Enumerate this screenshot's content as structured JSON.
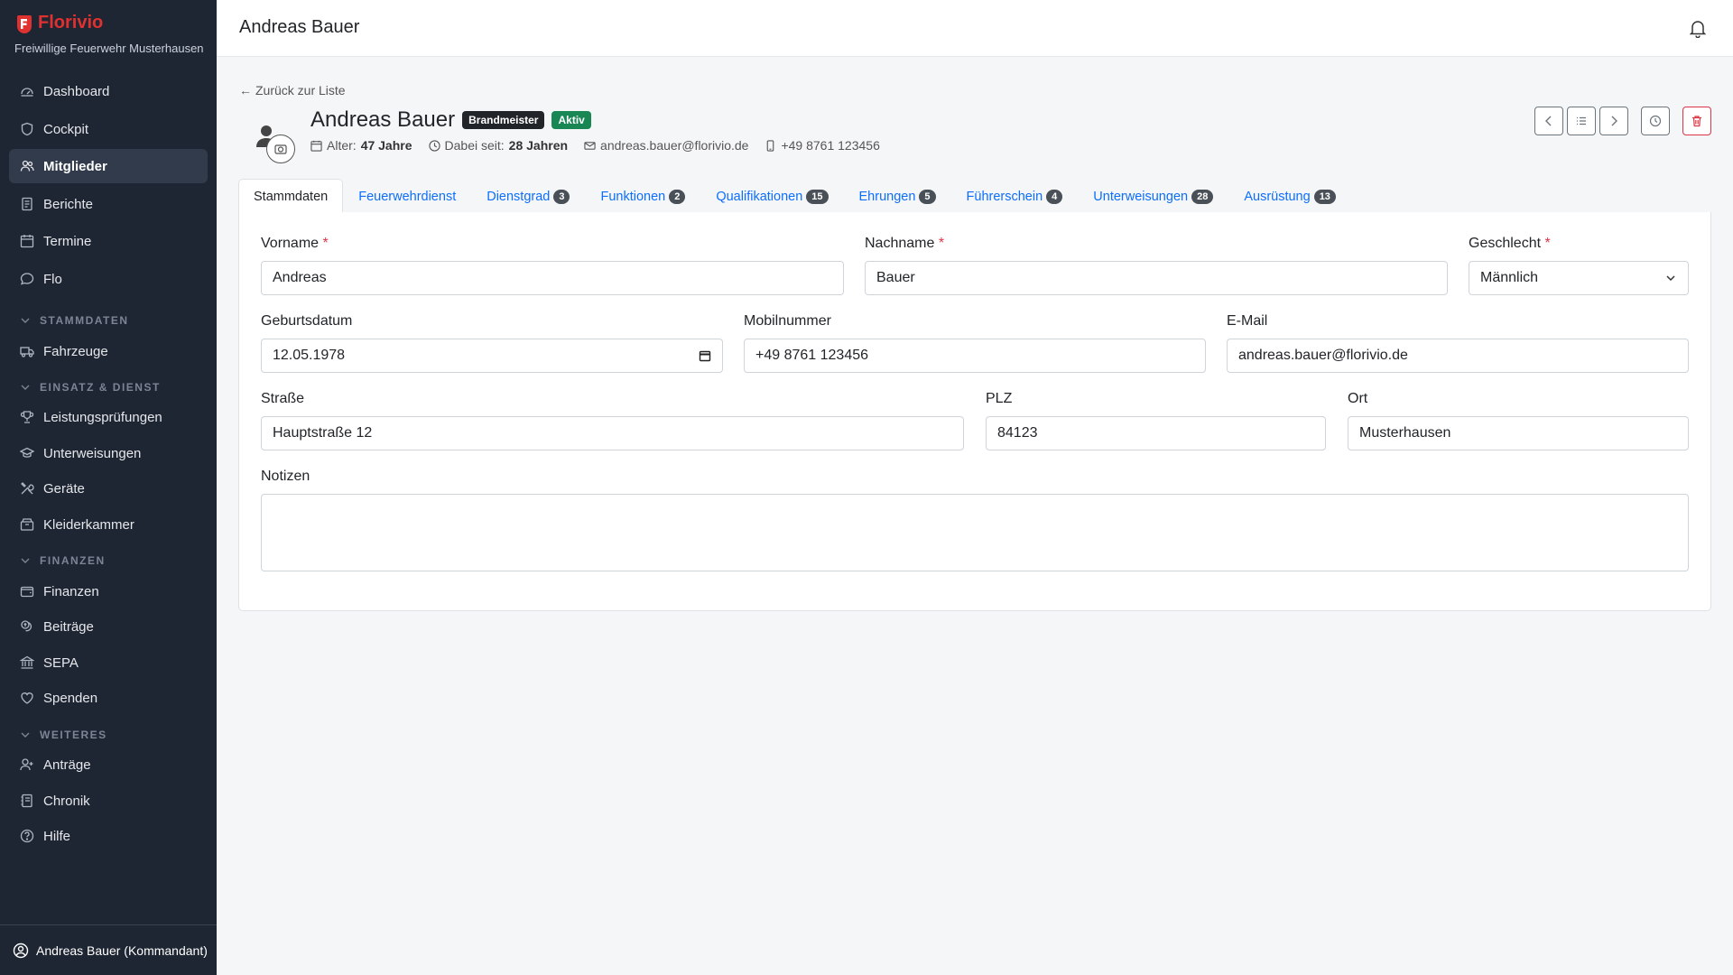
{
  "brand": {
    "name": "Florivio",
    "subtitle": "Freiwillige Feuerwehr Musterhausen"
  },
  "sidebar": {
    "items": [
      {
        "label": "Dashboard",
        "icon": "dashboard-icon"
      },
      {
        "label": "Cockpit",
        "icon": "shield-icon"
      },
      {
        "label": "Mitglieder",
        "icon": "users-icon",
        "active": true
      },
      {
        "label": "Berichte",
        "icon": "report-icon"
      },
      {
        "label": "Termine",
        "icon": "calendar-icon"
      },
      {
        "label": "Flo",
        "icon": "chat-icon"
      }
    ],
    "sections": [
      {
        "title": "STAMMDATEN",
        "items": [
          {
            "label": "Fahrzeuge",
            "icon": "truck-icon"
          }
        ]
      },
      {
        "title": "EINSATZ & DIENST",
        "items": [
          {
            "label": "Leistungsprüfungen",
            "icon": "trophy-icon"
          },
          {
            "label": "Unterweisungen",
            "icon": "graduation-icon"
          },
          {
            "label": "Geräte",
            "icon": "tools-icon"
          },
          {
            "label": "Kleiderkammer",
            "icon": "box-icon"
          }
        ]
      },
      {
        "title": "FINANZEN",
        "items": [
          {
            "label": "Finanzen",
            "icon": "wallet-icon"
          },
          {
            "label": "Beiträge",
            "icon": "coins-icon"
          },
          {
            "label": "SEPA",
            "icon": "bank-icon"
          },
          {
            "label": "Spenden",
            "icon": "heart-icon"
          }
        ]
      },
      {
        "title": "WEITERES",
        "items": [
          {
            "label": "Anträge",
            "icon": "user-add-icon"
          },
          {
            "label": "Chronik",
            "icon": "journal-icon"
          },
          {
            "label": "Hilfe",
            "icon": "help-icon"
          }
        ]
      }
    ],
    "footer_user": "Andreas Bauer (Kommandant)"
  },
  "topbar": {
    "title": "Andreas Bauer"
  },
  "main": {
    "back_label": "Zurück zur Liste",
    "person": {
      "name": "Andreas Bauer",
      "rank_badge": "Brandmeister",
      "status_badge": "Aktiv",
      "age_label": "Alter:",
      "age_value": "47 Jahre",
      "since_label": "Dabei seit:",
      "since_value": "28 Jahren",
      "email": "andreas.bauer@florivio.de",
      "phone": "+49 8761 123456"
    },
    "tabs": [
      {
        "label": "Stammdaten",
        "active": true
      },
      {
        "label": "Feuerwehrdienst"
      },
      {
        "label": "Dienstgrad",
        "count": "3"
      },
      {
        "label": "Funktionen",
        "count": "2"
      },
      {
        "label": "Qualifikationen",
        "count": "15"
      },
      {
        "label": "Ehrungen",
        "count": "5"
      },
      {
        "label": "Führerschein",
        "count": "4"
      },
      {
        "label": "Unterweisungen",
        "count": "28"
      },
      {
        "label": "Ausrüstung",
        "count": "13"
      }
    ],
    "form": {
      "vorname": {
        "label": "Vorname",
        "value": "Andreas"
      },
      "nachname": {
        "label": "Nachname",
        "value": "Bauer"
      },
      "geschlecht": {
        "label": "Geschlecht",
        "value": "Männlich"
      },
      "geburtsdatum": {
        "label": "Geburtsdatum",
        "value": "12.05.1978"
      },
      "mobilnummer": {
        "label": "Mobilnummer",
        "value": "+49 8761 123456"
      },
      "email": {
        "label": "E-Mail",
        "value": "andreas.bauer@florivio.de"
      },
      "strasse": {
        "label": "Straße",
        "value": "Hauptstraße 12"
      },
      "plz": {
        "label": "PLZ",
        "value": "84123"
      },
      "ort": {
        "label": "Ort",
        "value": "Musterhausen"
      },
      "notizen": {
        "label": "Notizen",
        "value": ""
      }
    }
  },
  "colors": {
    "brand": "#e03131",
    "sidebar_bg": "#1f2633",
    "link": "#0d6efd",
    "success": "#198754",
    "danger": "#dc3545"
  }
}
